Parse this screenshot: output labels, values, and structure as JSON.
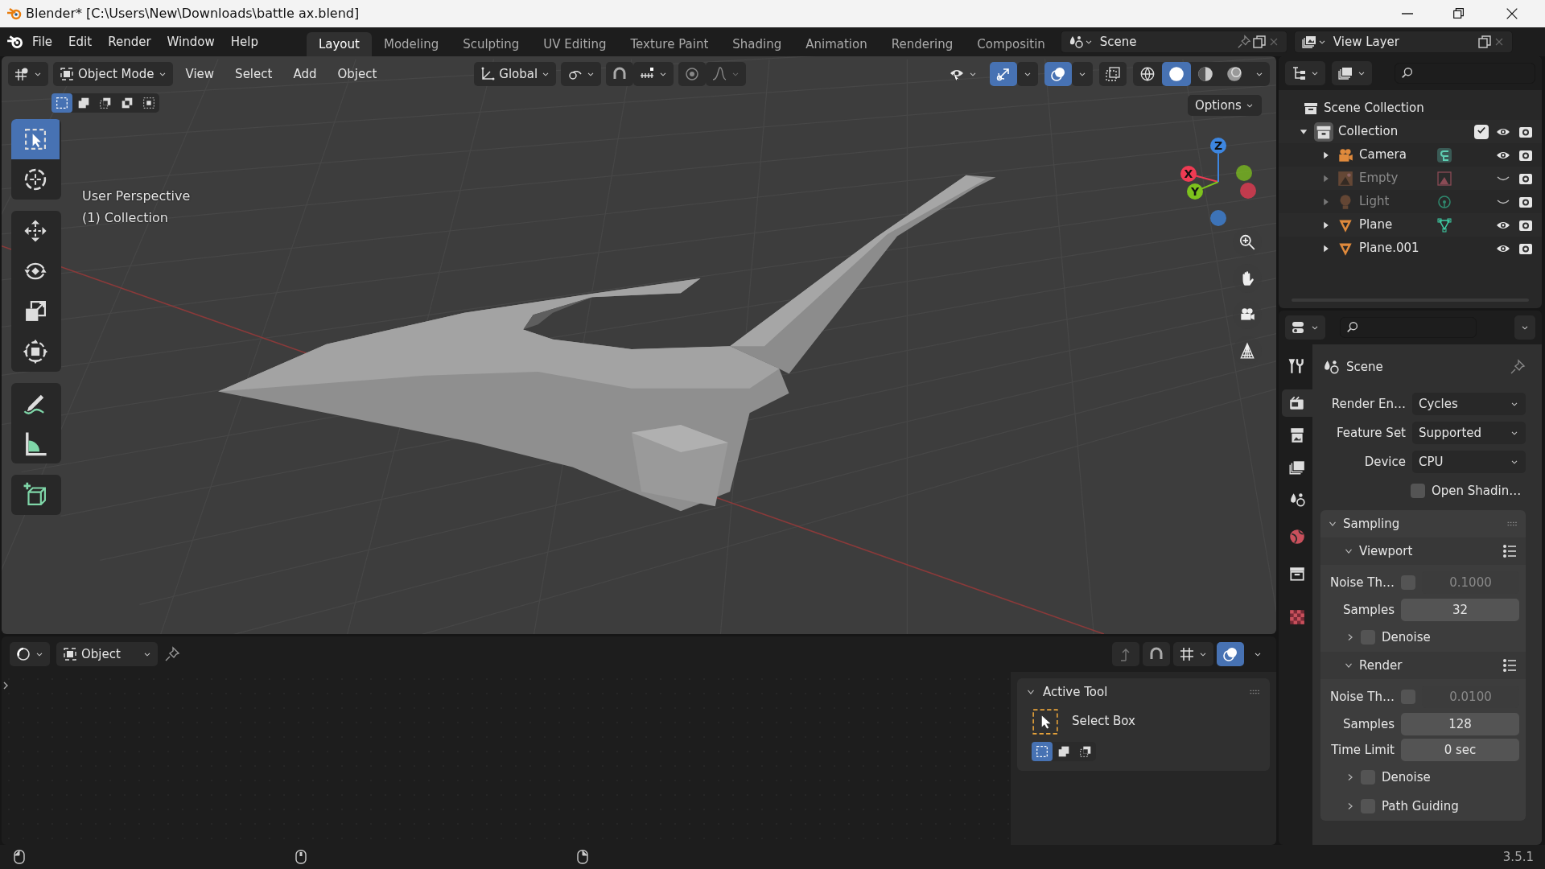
{
  "window": {
    "title": "Blender* [C:\\Users\\New\\Downloads\\battle ax.blend]"
  },
  "menu": [
    "File",
    "Edit",
    "Render",
    "Window",
    "Help"
  ],
  "workspaces": [
    {
      "label": "Layout",
      "selected": true
    },
    {
      "label": "Modeling",
      "selected": false
    },
    {
      "label": "Sculpting",
      "selected": false
    },
    {
      "label": "UV Editing",
      "selected": false
    },
    {
      "label": "Texture Paint",
      "selected": false
    },
    {
      "label": "Shading",
      "selected": false
    },
    {
      "label": "Animation",
      "selected": false
    },
    {
      "label": "Rendering",
      "selected": false
    },
    {
      "label": "Compositin",
      "selected": false
    }
  ],
  "scene": "Scene",
  "view_layer": "View Layer",
  "viewport": {
    "mode": "Object Mode",
    "menus": [
      "View",
      "Select",
      "Add",
      "Object"
    ],
    "orientation": "Global",
    "select_modes": [
      {
        "selected": true
      },
      {
        "selected": false
      },
      {
        "selected": false
      },
      {
        "selected": false
      },
      {
        "selected": false
      }
    ],
    "gizmos_on": true,
    "overlays_on": true,
    "shading": [
      {
        "kind": "wireframe",
        "selected": false
      },
      {
        "kind": "solid",
        "selected": true
      },
      {
        "kind": "material",
        "selected": false
      },
      {
        "kind": "rendered",
        "selected": false
      }
    ],
    "options": "Options",
    "overlay_lines": [
      "User Perspective",
      "(1) Collection"
    ],
    "tools": [
      {
        "kind": "select",
        "selected": true
      },
      {
        "kind": "cursor",
        "selected": false
      },
      {
        "kind": "move",
        "selected": false
      },
      {
        "kind": "rotate",
        "selected": false
      },
      {
        "kind": "scale",
        "selected": false
      },
      {
        "kind": "transform",
        "selected": false
      },
      {
        "kind": "annotate",
        "selected": false
      },
      {
        "kind": "measure",
        "selected": false
      },
      {
        "kind": "add-cube",
        "selected": false
      }
    ],
    "axes": [
      "X",
      "Y",
      "Z"
    ]
  },
  "outliner": {
    "root": "Scene Collection",
    "collections": [
      {
        "label": "Collection",
        "expanded": true,
        "checked": true,
        "visible": true,
        "children": [
          {
            "label": "Camera",
            "kind": "camera",
            "expanded": false,
            "visible": true
          },
          {
            "label": "Empty",
            "kind": "empty",
            "expanded": false,
            "visible": false
          },
          {
            "label": "Light",
            "kind": "light",
            "expanded": false,
            "visible": false
          },
          {
            "label": "Plane",
            "kind": "mesh",
            "expanded": false,
            "visible": true
          },
          {
            "label": "Plane.001",
            "kind": "mesh-nodata",
            "expanded": false,
            "visible": true
          }
        ]
      }
    ]
  },
  "properties": {
    "tabs": [
      {
        "kind": "tool",
        "selected": false
      },
      {
        "kind": "render",
        "selected": true
      },
      {
        "kind": "output",
        "selected": false
      },
      {
        "kind": "view-layer",
        "selected": false
      },
      {
        "kind": "scene",
        "selected": false
      },
      {
        "kind": "world",
        "selected": false
      },
      {
        "kind": "collection",
        "selected": false
      },
      {
        "kind": "texture",
        "selected": false
      }
    ],
    "context": "Scene",
    "rows": [
      {
        "kind": "dropdown",
        "label": "Render En…",
        "value": "Cycles"
      },
      {
        "kind": "dropdown",
        "label": "Feature Set",
        "value": "Supported"
      },
      {
        "kind": "dropdown",
        "label": "Device",
        "value": "CPU"
      },
      {
        "kind": "checkbox",
        "label": "Open Shadin…",
        "checked": false
      },
      {
        "kind": "section",
        "label": "Sampling",
        "expanded": true,
        "children": [
          {
            "kind": "subsection",
            "label": "Viewport",
            "expanded": true,
            "children": [
              {
                "kind": "threshold",
                "label": "Noise Th…",
                "checked": false,
                "disabled": true,
                "value": "0.1000"
              },
              {
                "kind": "number",
                "label": "Samples",
                "value": "32"
              },
              {
                "kind": "subpanel",
                "label": "Denoise",
                "expanded": false,
                "checked": false
              }
            ]
          },
          {
            "kind": "subsection",
            "label": "Render",
            "expanded": true,
            "children": [
              {
                "kind": "threshold",
                "label": "Noise Th…",
                "checked": false,
                "disabled": true,
                "value": "0.0100"
              },
              {
                "kind": "number",
                "label": "Samples",
                "value": "128"
              },
              {
                "kind": "number",
                "label": "Time Limit",
                "value": "0 sec"
              },
              {
                "kind": "subpanel",
                "label": "Denoise",
                "expanded": false,
                "checked": false
              },
              {
                "kind": "subpanel",
                "label": "Path Guiding",
                "expanded": false,
                "checked": false
              }
            ]
          }
        ]
      }
    ]
  },
  "editor": {
    "context": "Object",
    "active_tool": {
      "title": "Active Tool",
      "expanded": true,
      "tool": "Select Box",
      "modes": [
        {
          "selected": true
        },
        {
          "selected": false
        },
        {
          "selected": false
        }
      ]
    }
  },
  "status_bar": {
    "version": "3.5.1"
  }
}
